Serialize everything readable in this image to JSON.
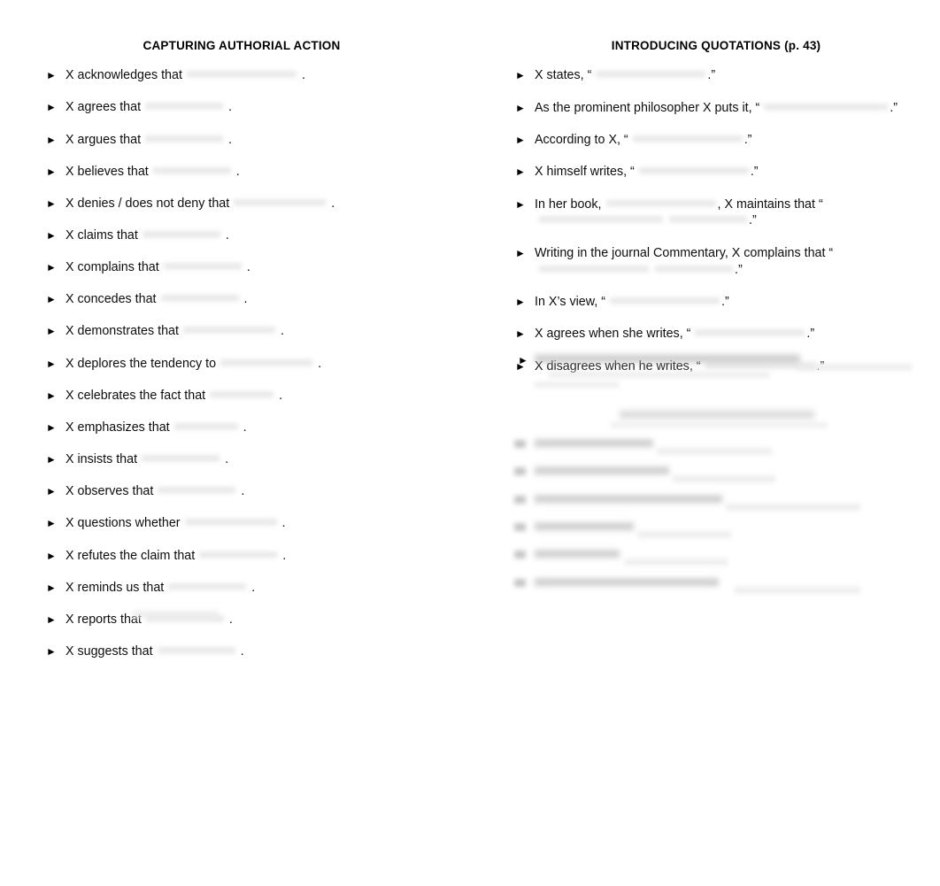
{
  "document": {
    "background_color": "#ffffff",
    "text_color": "#0d0d0d",
    "bullet_glyph": "►"
  },
  "left_column": {
    "heading": "CAPTURING AUTHORIAL ACTION",
    "items": [
      {
        "text": "X acknowledges that",
        "blank": "xl",
        "end": "."
      },
      {
        "text": "X agrees that",
        "blank": "md",
        "end": "."
      },
      {
        "text": "X argues that",
        "blank": "md",
        "end": "."
      },
      {
        "text": "X believes that",
        "blank": "md",
        "end": "."
      },
      {
        "text": "X denies / does not deny that",
        "blank": "lg",
        "end": "."
      },
      {
        "text": "X claims that",
        "blank": "md",
        "end": "."
      },
      {
        "text": "X complains that",
        "blank": "md",
        "end": "."
      },
      {
        "text": "X concedes that",
        "blank": "md",
        "end": "."
      },
      {
        "text": "X demonstrates that",
        "blank": "lg",
        "end": "."
      },
      {
        "text": "X deplores the tendency to",
        "blank": "lg",
        "end": "."
      },
      {
        "text": "X celebrates the fact that",
        "blank": "sm",
        "end": "."
      },
      {
        "text": "X emphasizes that",
        "blank": "sm",
        "end": "."
      },
      {
        "text": "X insists that",
        "blank": "md",
        "end": "."
      },
      {
        "text": "X observes that",
        "blank": "md",
        "end": "."
      },
      {
        "text": "X questions whether",
        "blank": "lg",
        "end": "."
      },
      {
        "text": "X refutes the claim that",
        "blank": "md",
        "end": "."
      },
      {
        "text": "X reminds us that",
        "blank": "md",
        "end": "."
      },
      {
        "text": "X reports that",
        "blank": "md",
        "end": "."
      },
      {
        "text": "X suggests that",
        "blank": "md",
        "end": "."
      }
    ]
  },
  "right_column": {
    "heading": "INTRODUCING QUOTATIONS (p. 43)",
    "items": [
      {
        "segments": [
          {
            "type": "text",
            "value": "X states, “"
          },
          {
            "type": "blank",
            "size": "xl"
          },
          {
            "type": "text",
            "value": ".”"
          }
        ]
      },
      {
        "segments": [
          {
            "type": "text",
            "value": "As the prominent philosopher X puts it, “"
          },
          {
            "type": "blank",
            "size": "xxl"
          },
          {
            "type": "text",
            "value": ".”"
          }
        ]
      },
      {
        "segments": [
          {
            "type": "text",
            "value": "According to X, “"
          },
          {
            "type": "blank",
            "size": "xl"
          },
          {
            "type": "text",
            "value": ".”"
          }
        ]
      },
      {
        "segments": [
          {
            "type": "text",
            "value": "X himself writes, “"
          },
          {
            "type": "blank",
            "size": "xl"
          },
          {
            "type": "text",
            "value": ".”"
          }
        ]
      },
      {
        "segments": [
          {
            "type": "text",
            "value": "In her book,"
          },
          {
            "type": "blank",
            "size": "xl"
          },
          {
            "type": "text",
            "value": ", X maintains that “"
          },
          {
            "type": "blank",
            "size": "xxl"
          },
          {
            "type": "blank",
            "size": "md"
          },
          {
            "type": "text",
            "value": ".”"
          }
        ]
      },
      {
        "segments": [
          {
            "type": "text",
            "value": "Writing in the journal "
          },
          {
            "type": "italic",
            "value": "Commentary"
          },
          {
            "type": "text",
            "value": ", X complains that “"
          },
          {
            "type": "blank",
            "size": "xl"
          },
          {
            "type": "blank",
            "size": "md"
          },
          {
            "type": "text",
            "value": ".”"
          }
        ]
      },
      {
        "segments": [
          {
            "type": "text",
            "value": "In X’s view, “"
          },
          {
            "type": "blank",
            "size": "xl"
          },
          {
            "type": "text",
            "value": ".”"
          }
        ]
      },
      {
        "segments": [
          {
            "type": "text",
            "value": "X agrees when she writes, “"
          },
          {
            "type": "blank",
            "size": "xl"
          },
          {
            "type": "text",
            "value": ".”"
          }
        ]
      },
      {
        "segments": [
          {
            "type": "text",
            "value": "X disagrees when he writes, “"
          },
          {
            "type": "blank",
            "size": "xl"
          },
          {
            "type": "text",
            "value": ".”"
          }
        ]
      }
    ],
    "obscured_note": "Remaining content in this column is blurred beyond legibility in the source screenshot."
  }
}
